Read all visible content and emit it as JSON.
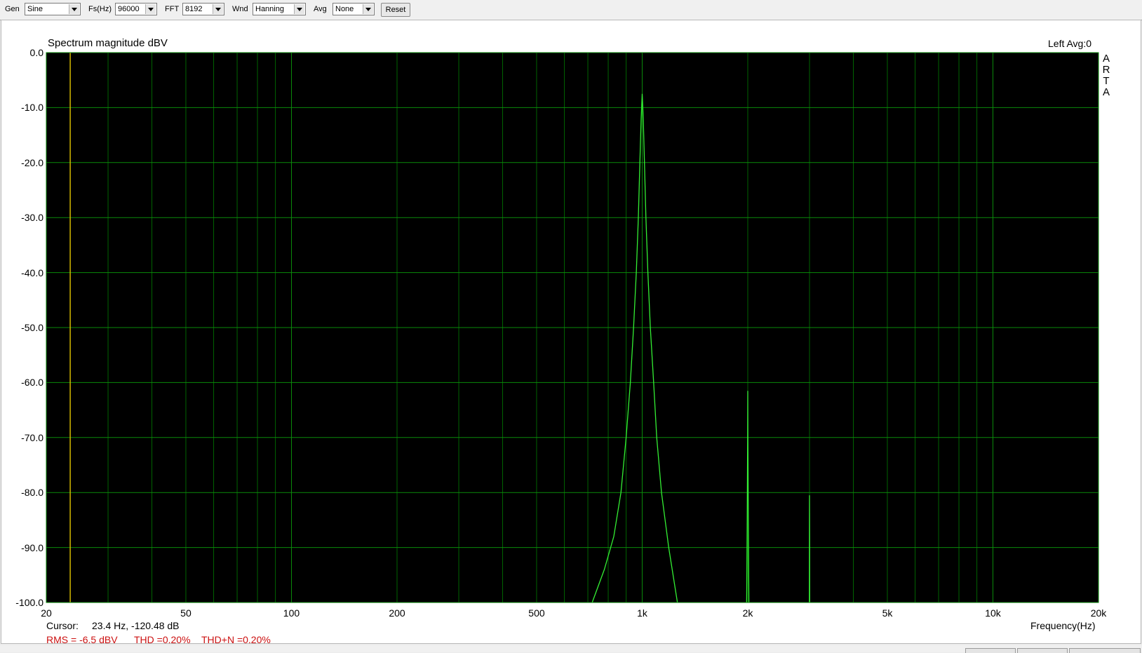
{
  "toolbar": {
    "gen_label": "Gen",
    "gen_value": "Sine",
    "fs_label": "Fs(Hz)",
    "fs_value": "96000",
    "fft_label": "FFT",
    "fft_value": "8192",
    "wnd_label": "Wnd",
    "wnd_value": "Hanning",
    "avg_label": "Avg",
    "avg_value": "None",
    "reset_label": "Reset"
  },
  "plot": {
    "title": "Spectrum magnitude dBV",
    "channel": "Left  Avg:0",
    "brand": [
      "A",
      "R",
      "T",
      "A"
    ],
    "cursor_label": "Cursor:",
    "cursor_value": "23.4 Hz, -120.48 dB",
    "rms": "RMS =   -6.5 dBV",
    "thd": "THD =0.20%",
    "thdn": "THD+N =0.20%",
    "xlabel": "Frequency(Hz)"
  },
  "colors": {
    "background": "#000000",
    "grid": "#006400",
    "trace": "#33ee33",
    "cursor": "#d4b800",
    "stats_text": "#cc1111"
  },
  "chart_data": {
    "type": "line",
    "title": "Spectrum magnitude dBV",
    "xlabel": "Frequency(Hz)",
    "ylabel": "",
    "xscale": "log",
    "xlim": [
      20,
      20000
    ],
    "ylim": [
      -100,
      0
    ],
    "grid": true,
    "xticks": [
      {
        "v": 20,
        "label": "20"
      },
      {
        "v": 50,
        "label": "50"
      },
      {
        "v": 100,
        "label": "100"
      },
      {
        "v": 200,
        "label": "200"
      },
      {
        "v": 500,
        "label": "500"
      },
      {
        "v": 1000,
        "label": "1k"
      },
      {
        "v": 2000,
        "label": "2k"
      },
      {
        "v": 5000,
        "label": "5k"
      },
      {
        "v": 10000,
        "label": "10k"
      },
      {
        "v": 20000,
        "label": "20k"
      }
    ],
    "yticks": [
      {
        "v": 0,
        "label": "0.0"
      },
      {
        "v": -10,
        "label": "-10.0"
      },
      {
        "v": -20,
        "label": "-20.0"
      },
      {
        "v": -30,
        "label": "-30.0"
      },
      {
        "v": -40,
        "label": "-40.0"
      },
      {
        "v": -50,
        "label": "-50.0"
      },
      {
        "v": -60,
        "label": "-60.0"
      },
      {
        "v": -70,
        "label": "-70.0"
      },
      {
        "v": -80,
        "label": "-80.0"
      },
      {
        "v": -90,
        "label": "-90.0"
      },
      {
        "v": -100,
        "label": "-100.0"
      }
    ],
    "cursor_frequency": 23.4,
    "series": [
      {
        "points": [
          [
            720,
            -100
          ],
          [
            780,
            -94
          ],
          [
            830,
            -88
          ],
          [
            870,
            -80
          ],
          [
            900,
            -70
          ],
          [
            925,
            -60
          ],
          [
            945,
            -50
          ],
          [
            962,
            -40
          ],
          [
            975,
            -30
          ],
          [
            985,
            -20
          ],
          [
            993,
            -12
          ],
          [
            1000,
            -7.5
          ],
          [
            1007,
            -12
          ],
          [
            1015,
            -20
          ],
          [
            1025,
            -30
          ],
          [
            1038,
            -40
          ],
          [
            1055,
            -50
          ],
          [
            1078,
            -60
          ],
          [
            1100,
            -70
          ],
          [
            1135,
            -80
          ],
          [
            1190,
            -90
          ],
          [
            1260,
            -100
          ]
        ]
      },
      {
        "points": [
          [
            1985,
            -100
          ],
          [
            1993,
            -85
          ],
          [
            1998,
            -70
          ],
          [
            2000,
            -61.5
          ],
          [
            2002,
            -70
          ],
          [
            2007,
            -85
          ],
          [
            2015,
            -100
          ]
        ]
      },
      {
        "points": [
          [
            2996,
            -100
          ],
          [
            2998,
            -88
          ],
          [
            3000,
            -80.5
          ],
          [
            3002,
            -88
          ],
          [
            3004,
            -100
          ]
        ]
      }
    ]
  }
}
